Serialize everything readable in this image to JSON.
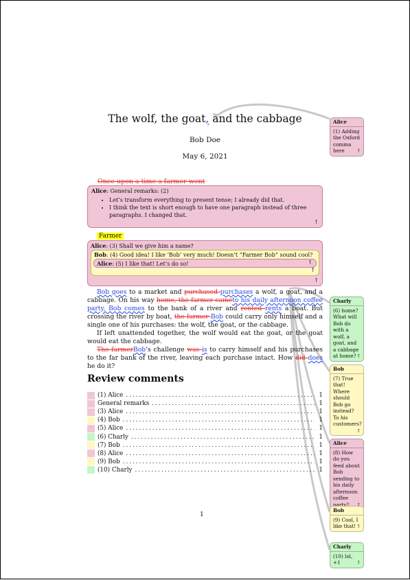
{
  "header": {
    "title": "The wolf, the goat, and the cabbage",
    "title_prefix": "The wolf, the goat",
    "title_comma": ",",
    "title_suffix": " and the cabbage",
    "author": "Bob Doe",
    "date": "May 6, 2021"
  },
  "deleted_line": "Once upon a time a farmer went",
  "general_comment": {
    "author": "Alice",
    "label": ": General remarks: (2)",
    "items": [
      "Let’s transform everything to present tense; I already did that.",
      "I think the text is short enough to have one paragraph instead of three paragraphs. I changed that."
    ],
    "arrow": "↑"
  },
  "farmer_highlight": "Farmer",
  "thread": {
    "c3_author": "Alice",
    "c3_text": ": (3) Shall we give him a name?",
    "c4_author": "Bob",
    "c4_text": ": (4) Good idea! I like ‘Bob’ very much! Doesn’t “Farmer Bob” sound cool?",
    "c5_author": "Alice",
    "c5_text": ": (5) I like that! Let’s do so!",
    "arrow": "↑"
  },
  "body": {
    "p1": {
      "ins1": "Bob goes",
      "t1": " to a market and ",
      "del1": "purchased ",
      "ins2": "purchases",
      "t2": " a wolf, a goat, and a cabbage. On his way ",
      "del2": "home, the farmer came",
      "ins3": "to his daily afternoon coffee party, Bob comes",
      "t3": " to the bank of a river and ",
      "del3": "rented ",
      "ins4": "rents",
      "t4": " a boat. But crossing the river by boat, ",
      "del4": "the farmer ",
      "ins5": "Bob",
      "t5": " could carry only himself and a single one of his purchases: the wolf, the goat, or the cabbage."
    },
    "p2": "If left unattended together, the wolf would eat the goat, or the goat would eat the cabbage.",
    "p3": {
      "del1": "The farmer",
      "ins1": "Bob",
      "t1": "’s challenge ",
      "del2": "was ",
      "ins2": "is",
      "t2": " to carry himself and his purchases to the far bank of the river, leaving each purchase intact. How ",
      "del3": "did ",
      "ins3": "does",
      "t3": " he do it?"
    }
  },
  "review": {
    "heading": "Review comments",
    "entries": [
      {
        "label": "(1) Alice",
        "page": "1",
        "color": "#f0c6d6"
      },
      {
        "label": "General remarks",
        "page": "1",
        "color": "#f0c6d6"
      },
      {
        "label": "(3) Alice",
        "page": "1",
        "color": "#f0c6d6"
      },
      {
        "label": "(4) Bob",
        "page": "1",
        "color": "#fff8c2"
      },
      {
        "label": "(5) Alice",
        "page": "1",
        "color": "#f0c6d6"
      },
      {
        "label": "(6) Charly",
        "page": "1",
        "color": "#c6f5c6"
      },
      {
        "label": "(7) Bob",
        "page": "1",
        "color": "#fff8c2"
      },
      {
        "label": "(8) Alice",
        "page": "1",
        "color": "#f0c6d6"
      },
      {
        "label": "(9) Bob",
        "page": "1",
        "color": "#fff8c2"
      },
      {
        "label": "(10) Charly",
        "page": "1",
        "color": "#c6f5c6"
      }
    ]
  },
  "page_number": "1",
  "margin_comments": [
    {
      "author": "Alice",
      "text": "(1) Adding the Oxford comma here",
      "arrow": "↑",
      "color": "#f0c6d6"
    },
    {
      "author": "Charly",
      "text": "(6) home? What will Bob do with a wolf, a goat, and a cabbage at home?",
      "arrow": "↑",
      "color": "#c6f5c6"
    },
    {
      "author": "Bob",
      "text": "(7) True that! Where should Bob go instead? To his customers?",
      "arrow": "↑",
      "color": "#fff8c2"
    },
    {
      "author": "Alice",
      "text": "(8) How do you feed about Bob sending to his daily afternoon coffee party?",
      "arrow": "↑",
      "color": "#f0c6d6"
    },
    {
      "author": "Bob",
      "text": "(9) Cool, I like that!",
      "arrow": "↑",
      "color": "#fff8c2"
    },
    {
      "author": "Charly",
      "text": "(10) lol, +1",
      "arrow": "↑",
      "color": "#c6f5c6"
    }
  ],
  "colors": {
    "alice": "#f0c6d6",
    "bob": "#fff8c2",
    "charly": "#c6f5c6",
    "deletion": "#e03030",
    "insertion": "#2244dd",
    "highlight": "#ffff00"
  }
}
